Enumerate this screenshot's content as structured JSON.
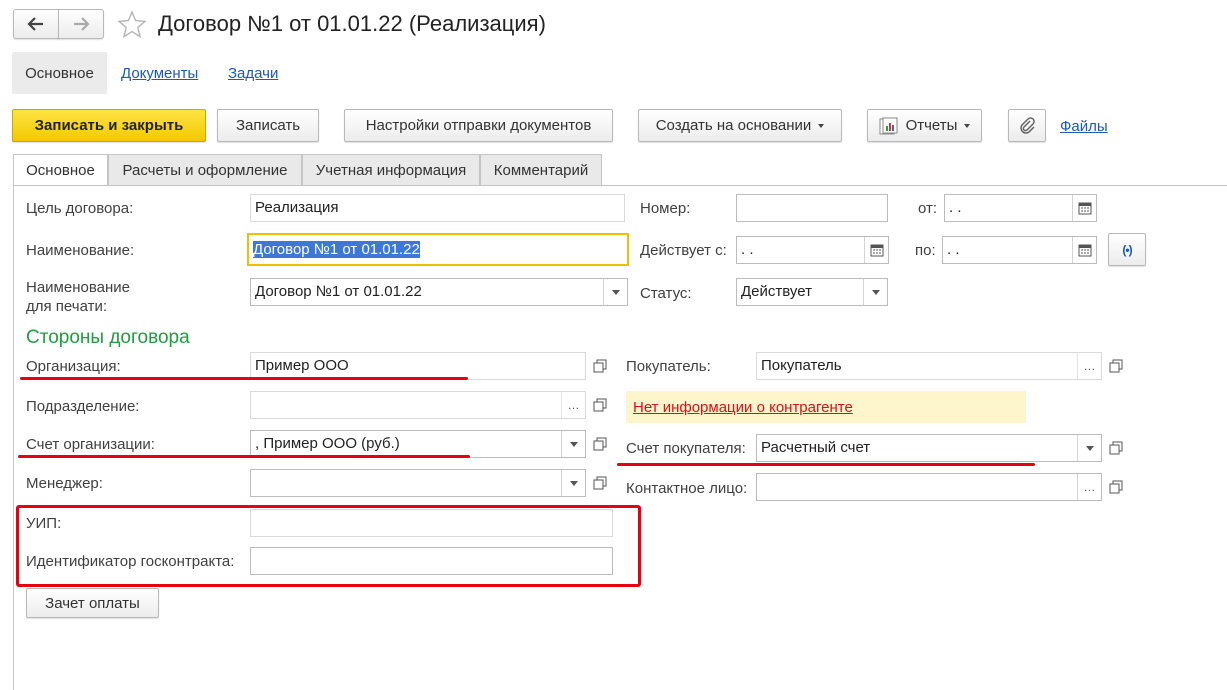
{
  "window": {
    "title": "Договор №1 от 01.01.22 (Реализация)",
    "nav_back": "back-arrow",
    "nav_forward": "forward-arrow",
    "favorite_icon": "star-icon"
  },
  "section_nav": {
    "items": [
      "Основное",
      "Документы",
      "Задачи"
    ]
  },
  "toolbar": {
    "save_close": "Записать и закрыть",
    "save": "Записать",
    "send_settings": "Настройки отправки документов",
    "create_based_on": "Создать на основании",
    "reports": "Отчеты",
    "files": "Файлы"
  },
  "tabs": [
    "Основное",
    "Расчеты и оформление",
    "Учетная информация",
    "Комментарий"
  ],
  "form": {
    "purpose_label": "Цель договора:",
    "purpose_value": "Реализация",
    "name_label": "Наименование:",
    "name_value": "Договор №1 от 01.01.22",
    "print_name_label_1": "Наименование",
    "print_name_label_2": "для печати:",
    "print_name_value": "Договор №1 от 01.01.22",
    "number_label": "Номер:",
    "number_value": "",
    "from_label": "от:",
    "from_value": " .  .",
    "valid_from_label": "Действует с:",
    "valid_from_value": " .  .",
    "to_label": "по:",
    "to_value": " .  .",
    "status_label": "Статус:",
    "status_value": "Действует"
  },
  "parties": {
    "header": "Стороны договора",
    "org_label": "Организация:",
    "org_value": "Пример ООО",
    "division_label": "Подразделение:",
    "division_value": "",
    "org_account_label": "Счет организации:",
    "org_account_value": ", Пример ООО (руб.)",
    "manager_label": "Менеджер:",
    "manager_value": "",
    "uip_label": "УИП:",
    "uip_value": "",
    "gov_id_label": "Идентификатор госконтракта:",
    "gov_id_value": "",
    "offset_button": "Зачет оплаты",
    "buyer_label": "Покупатель:",
    "buyer_value": "Покупатель",
    "warning": "Нет информации о контрагенте",
    "buyer_account_label": "Счет покупателя:",
    "buyer_account_value": "Расчетный счет",
    "contact_label": "Контактное лицо:",
    "contact_value": ""
  },
  "colors": {
    "accent_yellow": "#f2c900",
    "section_green": "#1e9e3f",
    "link_blue": "#1a5bb5",
    "annotation_red": "#e60012",
    "warning_bg": "#fdf6cc"
  }
}
